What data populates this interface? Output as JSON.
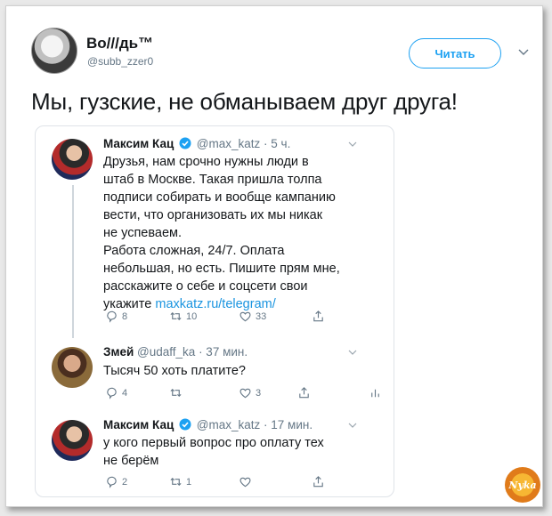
{
  "author": {
    "name": "Во///дь™",
    "handle": "@subb_zzer0"
  },
  "follow_label": "Читать",
  "tweet_text": "Мы, гузские, не обманываем друг друга!",
  "colors": {
    "accent": "#1da1f2",
    "muted": "#657786",
    "link": "#1b95e0"
  },
  "thread": [
    {
      "name": "Максим Кац",
      "verified": true,
      "handle": "@max_katz",
      "time": "· 5 ч.",
      "lines": [
        "Друзья, нам срочно нужны люди в",
        "штаб в Москве. Такая пришла толпа",
        "подписи собирать и вообще кампанию",
        "вести, что организовать их мы никак",
        "не успеваем.",
        "Работа сложная, 24/7. Оплата",
        "небольшая, но есть. Пишите прям мне,",
        "расскажите о себе и соцсети свои"
      ],
      "last_line_prefix": "укажите ",
      "link": "maxkatz.ru/telegram/",
      "replies": "8",
      "retweets": "10",
      "likes": "33"
    },
    {
      "name": "Змей",
      "verified": false,
      "handle": "@udaff_ka",
      "time": "· 37 мин.",
      "lines": [
        "Тысяч 50 хоть платите?"
      ],
      "replies": "4",
      "retweets": "",
      "likes": "3"
    },
    {
      "name": "Максим Кац",
      "verified": true,
      "handle": "@max_katz",
      "time": "· 17 мин.",
      "lines": [
        "у кого первый вопрос про оплату тех",
        "не берём"
      ],
      "replies": "2",
      "retweets": "1",
      "likes": ""
    }
  ],
  "watermark": "Nyka"
}
